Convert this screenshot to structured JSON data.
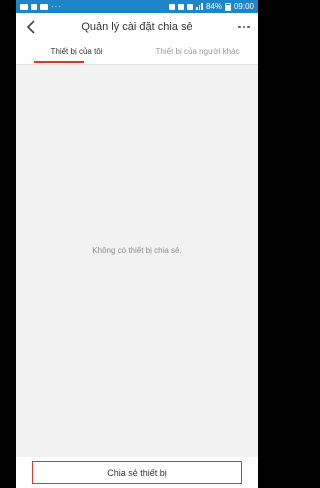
{
  "status_bar": {
    "battery": "84%",
    "time": "09:00"
  },
  "header": {
    "title": "Quản lý cài đặt chia sẻ"
  },
  "tabs": [
    {
      "label": "Thiết bị của tôi",
      "active": true
    },
    {
      "label": "Thiết bị của người khác",
      "active": false
    }
  ],
  "content": {
    "empty_message": "Không có thiết bị chia sẻ."
  },
  "footer": {
    "share_button_label": "Chia sẻ thiết bị"
  },
  "colors": {
    "status_bar": "#1e86c8",
    "accent": "#d83a2e",
    "background": "#f2f2f2"
  }
}
